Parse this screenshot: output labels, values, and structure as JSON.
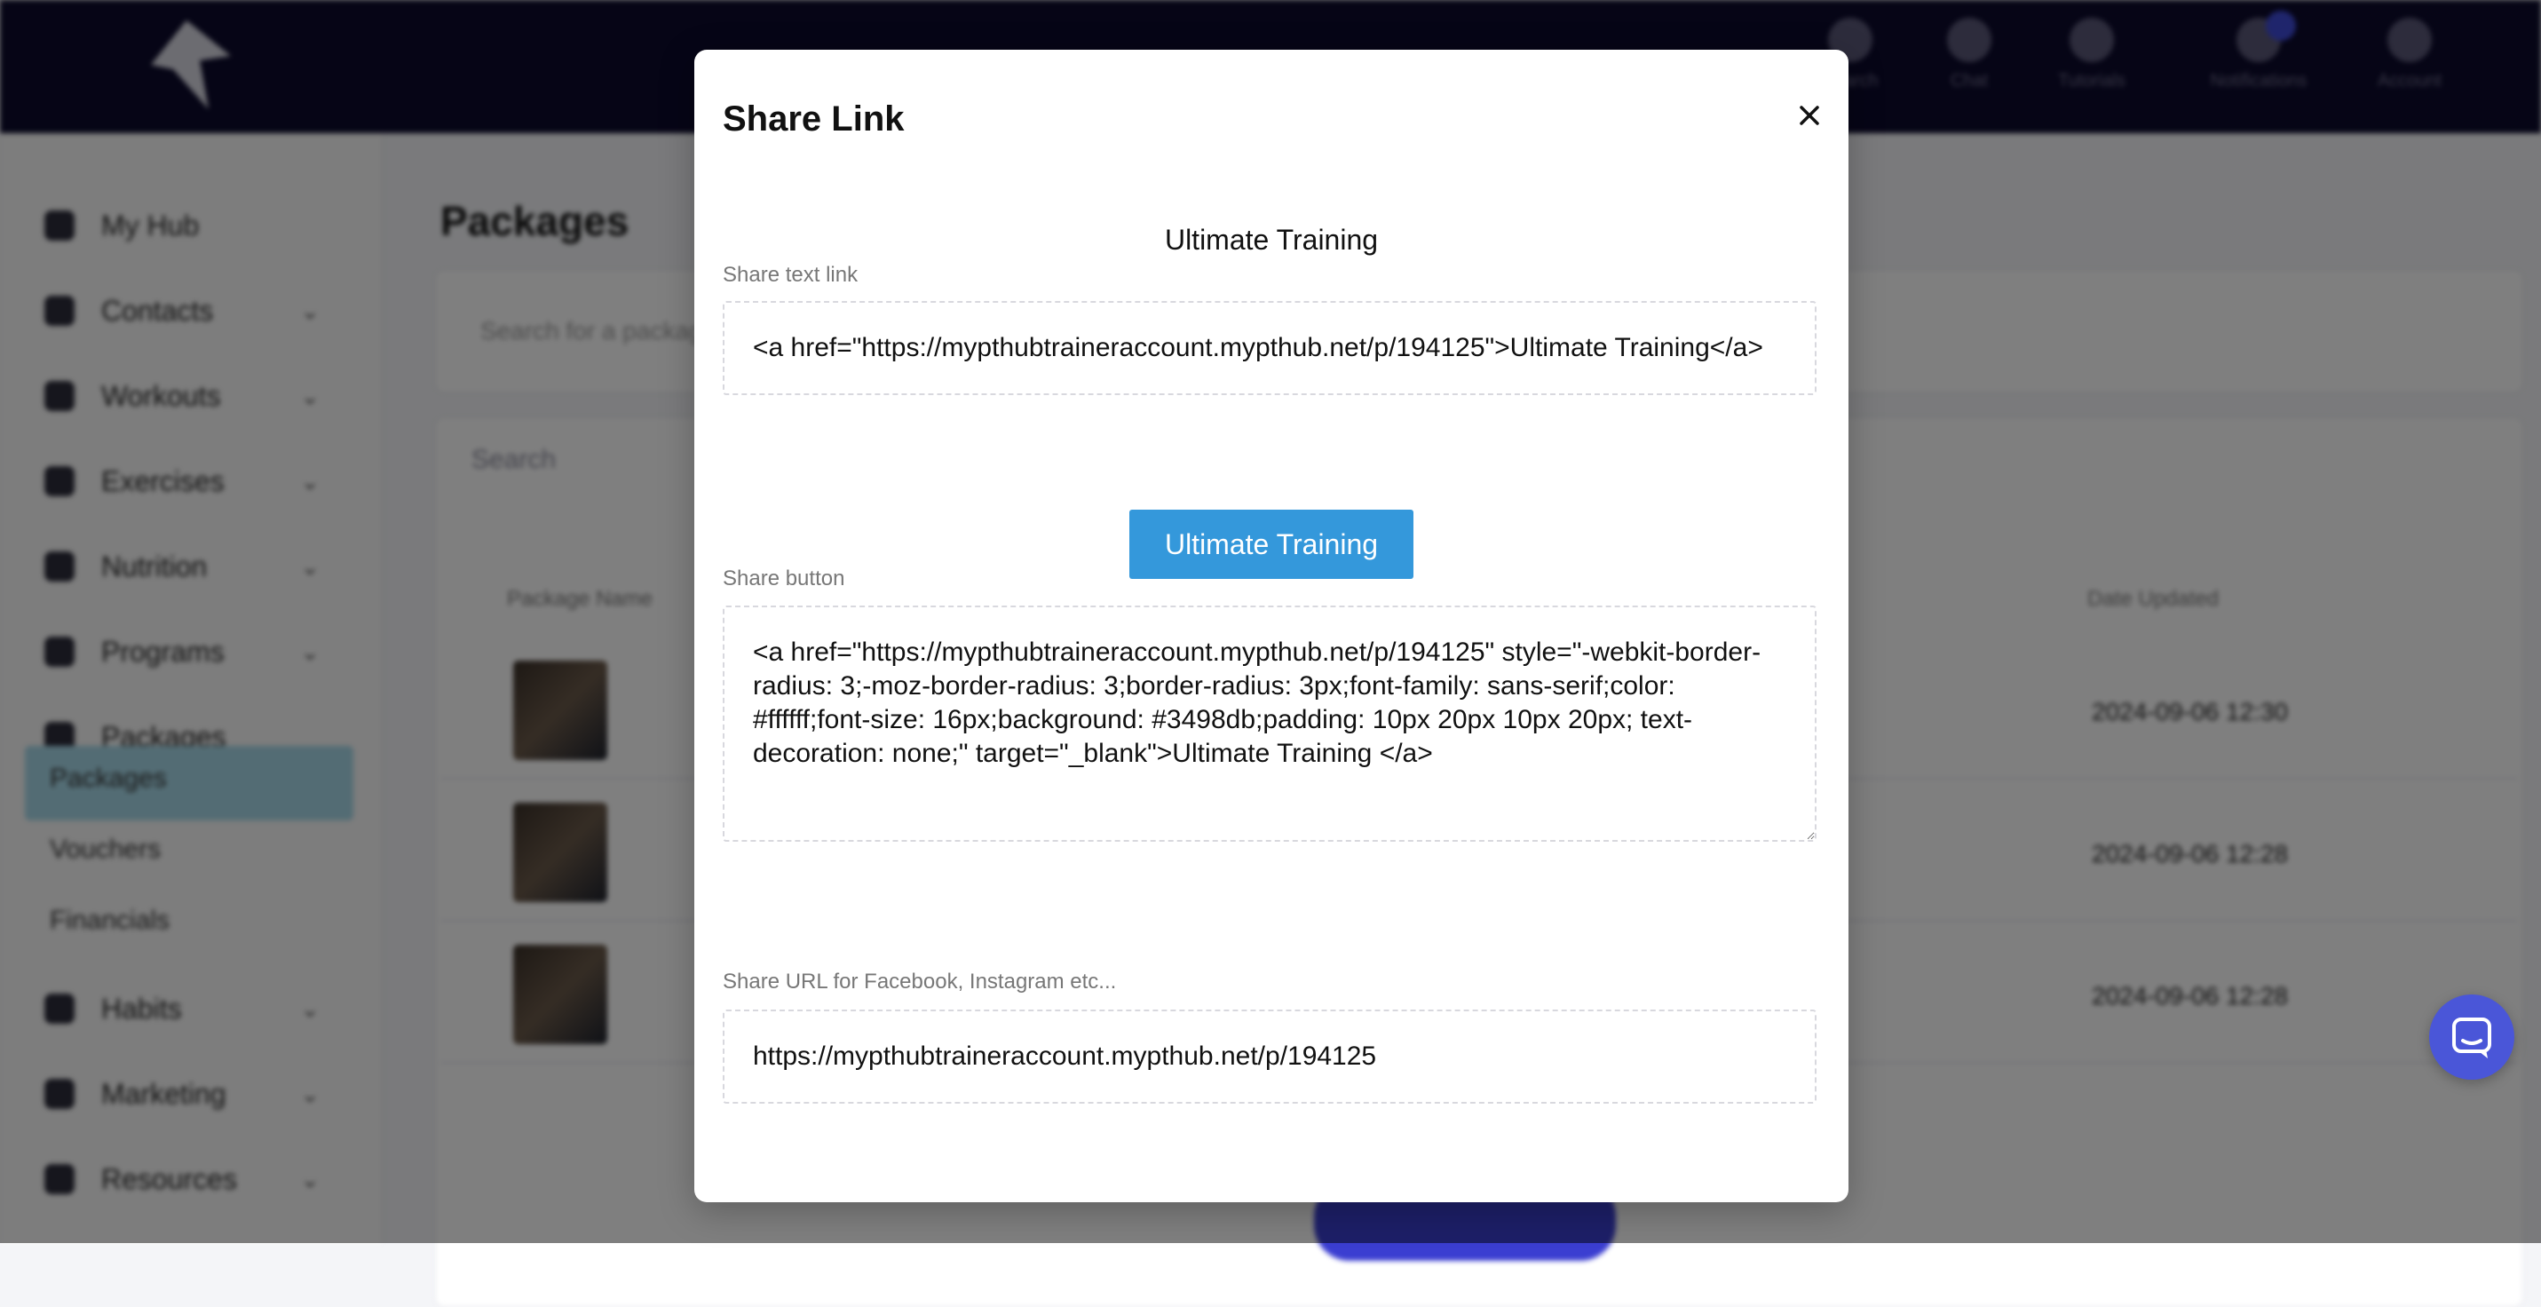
{
  "background": {
    "topnav": [
      "Search",
      "Chat",
      "Tutorials",
      "Notifications",
      "Account"
    ],
    "sidebar": {
      "items": [
        {
          "label": "My Hub",
          "icon": "home-icon"
        },
        {
          "label": "Contacts",
          "icon": "contacts-icon"
        },
        {
          "label": "Workouts",
          "icon": "workouts-icon"
        },
        {
          "label": "Exercises",
          "icon": "exercises-icon"
        },
        {
          "label": "Nutrition",
          "icon": "nutrition-icon"
        },
        {
          "label": "Programs",
          "icon": "programs-icon"
        },
        {
          "label": "Packages",
          "icon": "packages-icon"
        }
      ],
      "sub_items": [
        "Packages",
        "Vouchers",
        "Financials"
      ],
      "items_bottom": [
        {
          "label": "Habits",
          "icon": "habits-icon"
        },
        {
          "label": "Marketing",
          "icon": "marketing-icon"
        },
        {
          "label": "Resources",
          "icon": "resources-icon"
        }
      ]
    },
    "page_title": "Packages",
    "search_placeholder": "Search",
    "filter_placeholder": "Search for a package",
    "table": {
      "headers": [
        "Package Name",
        "Date Updated"
      ],
      "rows": [
        {
          "updated": "2024-09-06 12:30"
        },
        {
          "updated": "2024-09-06 12:28"
        },
        {
          "updated": "2024-09-06 12:28"
        }
      ]
    }
  },
  "modal": {
    "title": "Share Link",
    "package_name": "Ultimate Training",
    "text_link": {
      "label": "Share text link",
      "value": "<a href=\"https://mypthubtraineraccount.mypthub.net/p/194125\">Ultimate Training</a>"
    },
    "button_preview_label": "Ultimate Training",
    "share_button": {
      "label": "Share button",
      "value": "<a href=\"https://mypthubtraineraccount.mypthub.net/p/194125\" style=\"-webkit-border-radius: 3;-moz-border-radius: 3;border-radius: 3px;font-family: sans-serif;color: #ffffff;font-size: 16px;background: #3498db;padding: 10px 20px 10px 20px; text-decoration: none;\" target=\"_blank\">Ultimate Training </a>"
    },
    "share_url": {
      "label": "Share URL for Facebook, Instagram etc...",
      "value": "https://mypthubtraineraccount.mypthub.net/p/194125"
    }
  },
  "colors": {
    "topbar": "#0c0a2c",
    "button": "#3498db",
    "chat_fab": "#4a56d8"
  }
}
